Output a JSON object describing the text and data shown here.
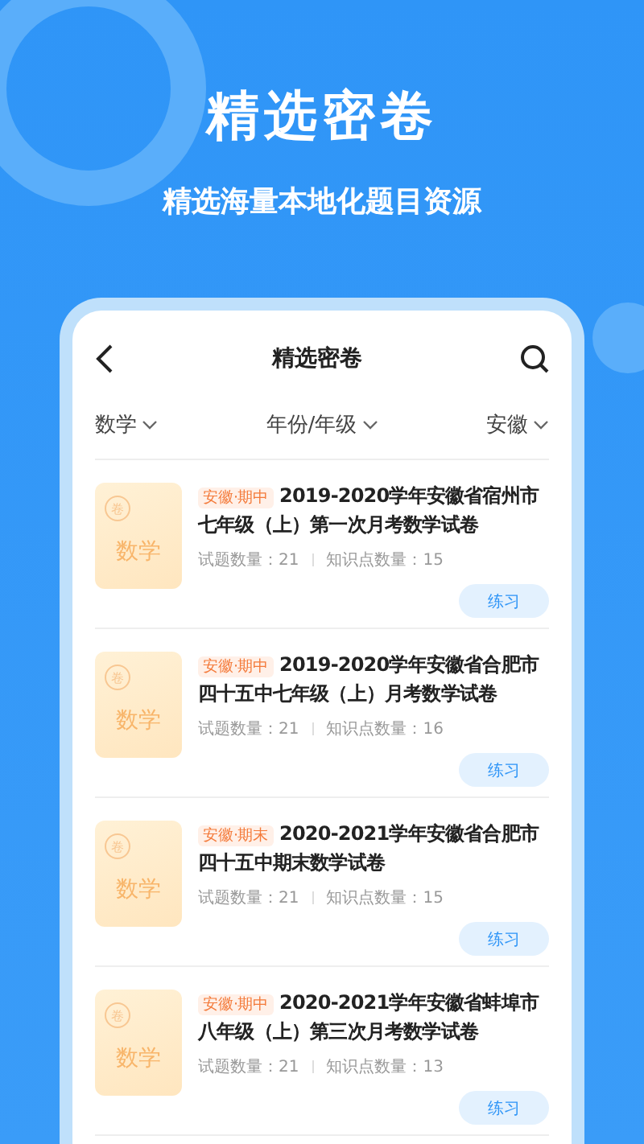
{
  "hero": {
    "title": "精选密卷",
    "subtitle": "精选海量本地化题目资源"
  },
  "header": {
    "title": "精选密卷"
  },
  "filters": [
    {
      "label": "数学"
    },
    {
      "label": "年份/年级"
    },
    {
      "label": "安徽"
    }
  ],
  "papers": [
    {
      "cover_stamp": "卷",
      "cover_subject": "数学",
      "tag": "安徽·期中",
      "title_lines": [
        "2019-2020学年安徽省宿州市",
        "七年级（上）第一次月考数学试卷"
      ],
      "questions": "试题数量：21",
      "points": "知识点数量：15",
      "button": "练习"
    },
    {
      "cover_stamp": "卷",
      "cover_subject": "数学",
      "tag": "安徽·期中",
      "title_lines": [
        "2019-2020学年安徽省合肥市",
        "四十五中七年级（上）月考数学试卷"
      ],
      "questions": "试题数量：21",
      "points": "知识点数量：16",
      "button": "练习"
    },
    {
      "cover_stamp": "卷",
      "cover_subject": "数学",
      "tag": "安徽·期末",
      "title_lines": [
        "2020-2021学年安徽省合肥市",
        "四十五中期末数学试卷"
      ],
      "questions": "试题数量：21",
      "points": "知识点数量：15",
      "button": "练习"
    },
    {
      "cover_stamp": "卷",
      "cover_subject": "数学",
      "tag": "安徽·期中",
      "title_lines": [
        "2020-2021学年安徽省蚌埠市",
        "八年级（上）第三次月考数学试卷"
      ],
      "questions": "试题数量：21",
      "points": "知识点数量：13",
      "button": "练习"
    }
  ]
}
